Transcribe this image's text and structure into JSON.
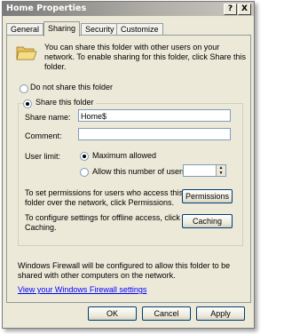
{
  "window": {
    "title": "Home Properties",
    "help_label": "?",
    "close_label": "X"
  },
  "tabs": [
    {
      "label": "General"
    },
    {
      "label": "Sharing"
    },
    {
      "label": "Security"
    },
    {
      "label": "Customize"
    }
  ],
  "sharing": {
    "intro_line1": "You can share this folder with other users on your",
    "intro_line2": "network. To enable sharing for this folder, click Share this",
    "intro_line3": "folder.",
    "do_not_share_label": "Do not share this folder",
    "share_label": "Share this folder",
    "selected_option": "share",
    "share_name_label": "Share name:",
    "share_name_value": "Home$",
    "comment_label": "Comment:",
    "comment_value": "",
    "user_limit_label": "User limit:",
    "max_allowed_label": "Maximum allowed",
    "allow_number_label": "Allow this number of users:",
    "user_limit_selected": "maximum",
    "permissions_text_line1": "To set permissions for users who access this",
    "permissions_text_line2": "folder over the network, click Permissions.",
    "permissions_button": "Permissions",
    "caching_text_line1": "To configure settings for offline access, click",
    "caching_text_line2": "Caching.",
    "caching_button": "Caching",
    "firewall_line1": "Windows Firewall will be configured to allow this folder to be",
    "firewall_line2": "shared with other computers on the network.",
    "firewall_link": "View your Windows Firewall settings"
  },
  "footer": {
    "ok": "OK",
    "cancel": "Cancel",
    "apply": "Apply"
  }
}
